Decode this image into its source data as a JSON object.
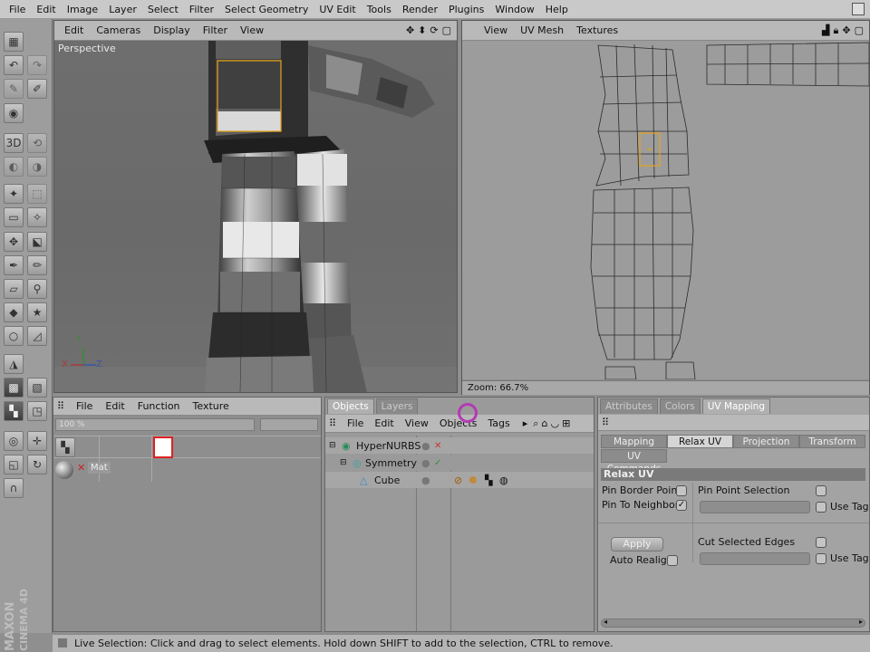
{
  "menubar": {
    "items": [
      "File",
      "Edit",
      "Image",
      "Layer",
      "Select",
      "Filter",
      "Select Geometry",
      "UV Edit",
      "Tools",
      "Render",
      "Plugins",
      "Window",
      "Help"
    ]
  },
  "viewport": {
    "menu": [
      "Edit",
      "Cameras",
      "Display",
      "Filter",
      "View"
    ],
    "label": "Perspective",
    "axes": {
      "x": "X",
      "y": "Y",
      "z": "Z"
    }
  },
  "uv_editor": {
    "menu": [
      "View",
      "UV Mesh",
      "Textures"
    ],
    "zoom": "Zoom: 66.7%"
  },
  "material_manager": {
    "menu": [
      "File",
      "Edit",
      "Function",
      "Texture"
    ],
    "zoom_value": "100 %",
    "material_name": "Mat"
  },
  "object_manager": {
    "tabs": [
      "Objects",
      "Layers"
    ],
    "menu": [
      "File",
      "Edit",
      "View",
      "Objects",
      "Tags"
    ],
    "objects": [
      {
        "name": "HyperNURBS",
        "depth": 0
      },
      {
        "name": "Symmetry",
        "depth": 1
      },
      {
        "name": "Cube",
        "depth": 2
      }
    ]
  },
  "attributes": {
    "tabs": [
      "Attributes",
      "Colors",
      "UV Mapping"
    ],
    "subtabs": [
      "Mapping",
      "Relax UV",
      "Projection",
      "Transform",
      "UV Commands"
    ],
    "section_title": "Relax UV",
    "pin_border_points": "Pin Border Points",
    "pin_to_neighbors": "Pin To Neighbors",
    "pin_point_selection": "Pin Point Selection",
    "use_tag_1": "Use Tag",
    "apply": "Apply",
    "auto_realign": "Auto Realign",
    "cut_selected_edges": "Cut Selected Edges",
    "use_tag_2": "Use Tag",
    "pin_to_neighbors_checked": true
  },
  "status_bar": {
    "text": "Live Selection: Click and drag to select elements. Hold down SHIFT to add to the selection, CTRL to remove."
  },
  "branding": {
    "maxon": "MAXON",
    "product": "CINEMA 4D"
  },
  "colors": {
    "selection": "#e5a31a",
    "active_tab": "#b0b0b0"
  }
}
